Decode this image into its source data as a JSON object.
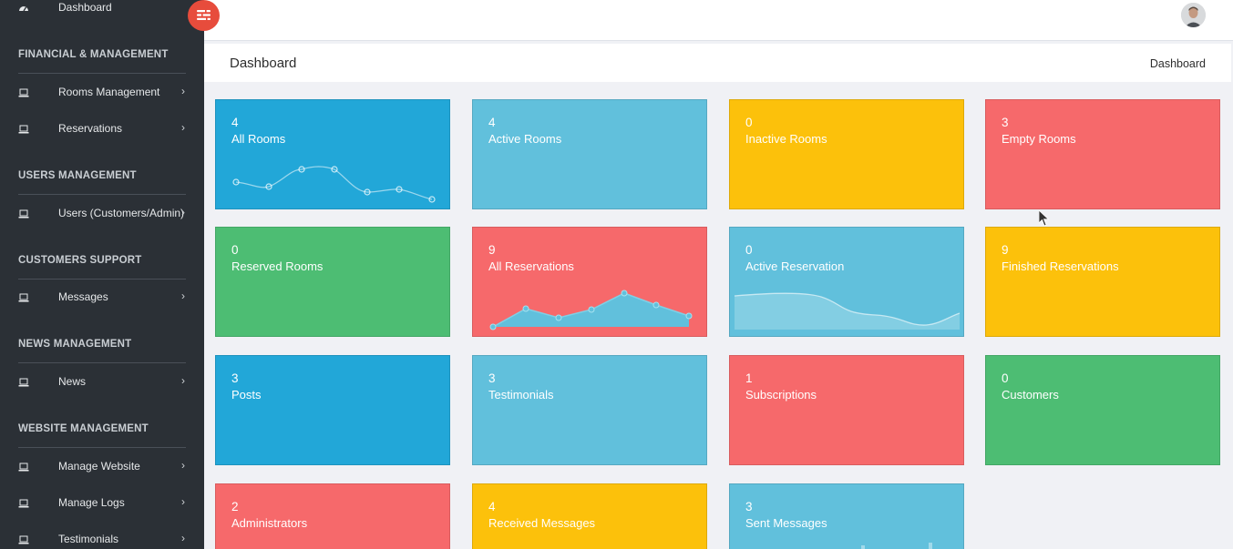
{
  "sidebar": {
    "dashboard_label": "Dashboard",
    "sections": [
      {
        "title": "FINANCIAL & MANAGEMENT"
      },
      {
        "title": "USERS MANAGEMENT"
      },
      {
        "title": "CUSTOMERS SUPPORT"
      },
      {
        "title": "NEWS MANAGEMENT"
      },
      {
        "title": "WEBSITE MANAGEMENT"
      }
    ],
    "items": [
      {
        "label": "Rooms Management",
        "icon": "laptop-icon"
      },
      {
        "label": "Reservations",
        "icon": "laptop-icon"
      },
      {
        "label": "Users (Customers/Admin)",
        "icon": "laptop-icon"
      },
      {
        "label": "Messages",
        "icon": "laptop-icon"
      },
      {
        "label": "News",
        "icon": "laptop-icon"
      },
      {
        "label": "Manage Website",
        "icon": "laptop-icon"
      },
      {
        "label": "Manage Logs",
        "icon": "laptop-icon"
      },
      {
        "label": "Testimonials",
        "icon": "laptop-icon"
      }
    ]
  },
  "header": {
    "page_title": "Dashboard",
    "breadcrumb": "Dashboard"
  },
  "colors": {
    "blue": "#22a7d8",
    "light_blue": "#61c0dc",
    "yellow": "#fcc10b",
    "red": "#f6696b",
    "green": "#4dbd73",
    "toggle": "#e74c3c"
  },
  "cards": [
    {
      "value": "4",
      "label": "All Rooms",
      "color": "blue"
    },
    {
      "value": "4",
      "label": "Active Rooms",
      "color": "light_blue"
    },
    {
      "value": "0",
      "label": "Inactive Rooms",
      "color": "yellow"
    },
    {
      "value": "3",
      "label": "Empty Rooms",
      "color": "red"
    },
    {
      "value": "0",
      "label": "Reserved Rooms",
      "color": "green"
    },
    {
      "value": "9",
      "label": "All Reservations",
      "color": "red"
    },
    {
      "value": "0",
      "label": "Active Reservation",
      "color": "light_blue"
    },
    {
      "value": "9",
      "label": "Finished Reservations",
      "color": "yellow"
    },
    {
      "value": "3",
      "label": "Posts",
      "color": "blue"
    },
    {
      "value": "3",
      "label": "Testimonials",
      "color": "light_blue"
    },
    {
      "value": "1",
      "label": "Subscriptions",
      "color": "red"
    },
    {
      "value": "0",
      "label": "Customers",
      "color": "green"
    },
    {
      "value": "2",
      "label": "Administrators",
      "color": "red"
    },
    {
      "value": "4",
      "label": "Received Messages",
      "color": "yellow"
    },
    {
      "value": "3",
      "label": "Sent Messages",
      "color": "light_blue"
    }
  ]
}
